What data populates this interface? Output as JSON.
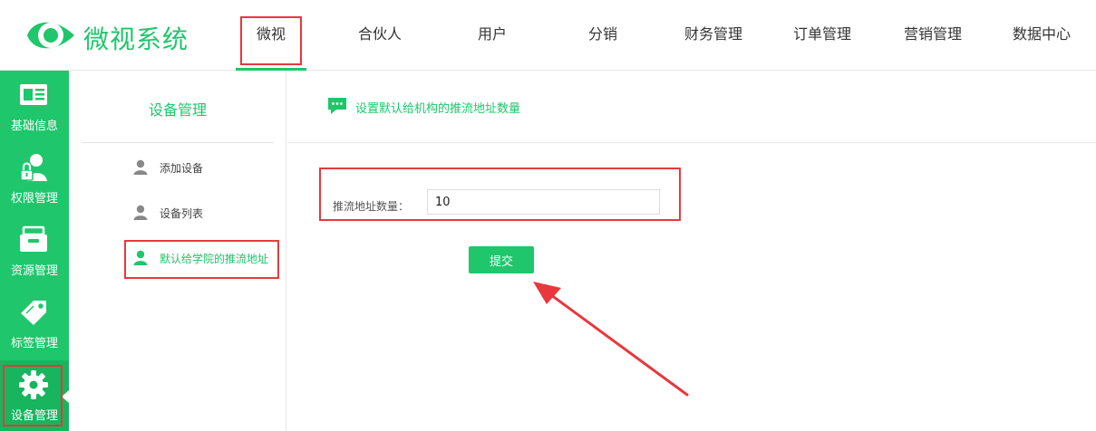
{
  "app": {
    "logo_text": "微视系统",
    "brand_color": "#1fc66b",
    "annotation_color": "#e8383d"
  },
  "nav": {
    "items": [
      {
        "label": "微视",
        "active": true
      },
      {
        "label": "合伙人"
      },
      {
        "label": "用户"
      },
      {
        "label": "分销"
      },
      {
        "label": "财务管理"
      },
      {
        "label": "订单管理"
      },
      {
        "label": "营销管理"
      },
      {
        "label": "数据中心"
      }
    ]
  },
  "sidebar": {
    "items": [
      {
        "label": "基础信息",
        "icon": "id-card-icon"
      },
      {
        "label": "权限管理",
        "icon": "user-lock-icon"
      },
      {
        "label": "资源管理",
        "icon": "drawer-icon"
      },
      {
        "label": "标签管理",
        "icon": "tag-icon"
      },
      {
        "label": "设备管理",
        "icon": "gear-icon",
        "active": true
      }
    ]
  },
  "submenu": {
    "title": "设备管理",
    "items": [
      {
        "label": "添加设备",
        "icon": "user-icon"
      },
      {
        "label": "设备列表",
        "icon": "user-icon"
      },
      {
        "label": "默认给学院的推流地址",
        "icon": "user-icon",
        "active": true
      }
    ]
  },
  "panel": {
    "title": "设置默认给机构的推流地址数量",
    "icon": "chat-bubble-icon"
  },
  "form": {
    "label": "推流地址数量：",
    "value": "10",
    "submit_label": "提交"
  }
}
